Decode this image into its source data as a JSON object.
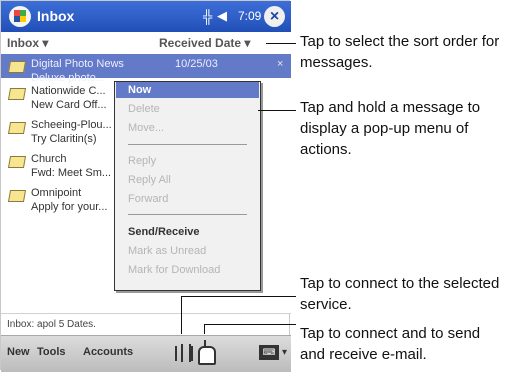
{
  "titlebar": {
    "title": "Inbox",
    "time": "7:09",
    "signal_icon": "signal-icon",
    "speaker_icon": "speaker-icon",
    "close_glyph": "×"
  },
  "sortbar": {
    "folder": "Inbox ▾",
    "sort_by": "Received Date ▾"
  },
  "messages": [
    {
      "sender": "Digital Photo News",
      "subject": "Deluxe photo...",
      "date": "10/25/03",
      "x": "×",
      "selected": true
    },
    {
      "sender": "Nationwide C...",
      "subject": "New Card Off...",
      "date": "",
      "x": "",
      "selected": false
    },
    {
      "sender": "Scheeing-Plou...",
      "subject": "Try Claritin(s)",
      "date": "",
      "x": "",
      "selected": false
    },
    {
      "sender": "Church",
      "subject": "Fwd: Meet Sm...",
      "date": "",
      "x": "",
      "selected": false
    },
    {
      "sender": "Omnipoint",
      "subject": "Apply for your...",
      "date": "",
      "x": "",
      "selected": false
    }
  ],
  "context_menu": {
    "items": [
      {
        "label": "Now",
        "state": "active"
      },
      {
        "label": "Delete",
        "state": "disabled"
      },
      {
        "label": "Move...",
        "state": "disabled"
      },
      {
        "label": "Reply",
        "state": "disabled"
      },
      {
        "label": "Reply All",
        "state": "disabled"
      },
      {
        "label": "Forward",
        "state": "disabled"
      },
      {
        "label": "Send/Receive",
        "state": "bold"
      },
      {
        "label": "Mark as Unread",
        "state": "disabled"
      },
      {
        "label": "Mark for Download",
        "state": "disabled"
      }
    ]
  },
  "status": {
    "text": "Inbox: apol 5 Dates."
  },
  "toolbar": {
    "new": "New",
    "tools": "Tools",
    "accounts": "Accounts",
    "keyboard_label": "⌨",
    "caret": "▾"
  },
  "callouts": {
    "sort": "Tap to select the sort order for messages.",
    "hold": "Tap and hold a message to display a pop-up menu of actions.",
    "connect": "Tap to connect to the selected service.",
    "send_receive": "Tap to connect and to send and receive e-mail."
  },
  "colors": {
    "title_blue": "#214fb7",
    "selection": "#637ac8"
  }
}
